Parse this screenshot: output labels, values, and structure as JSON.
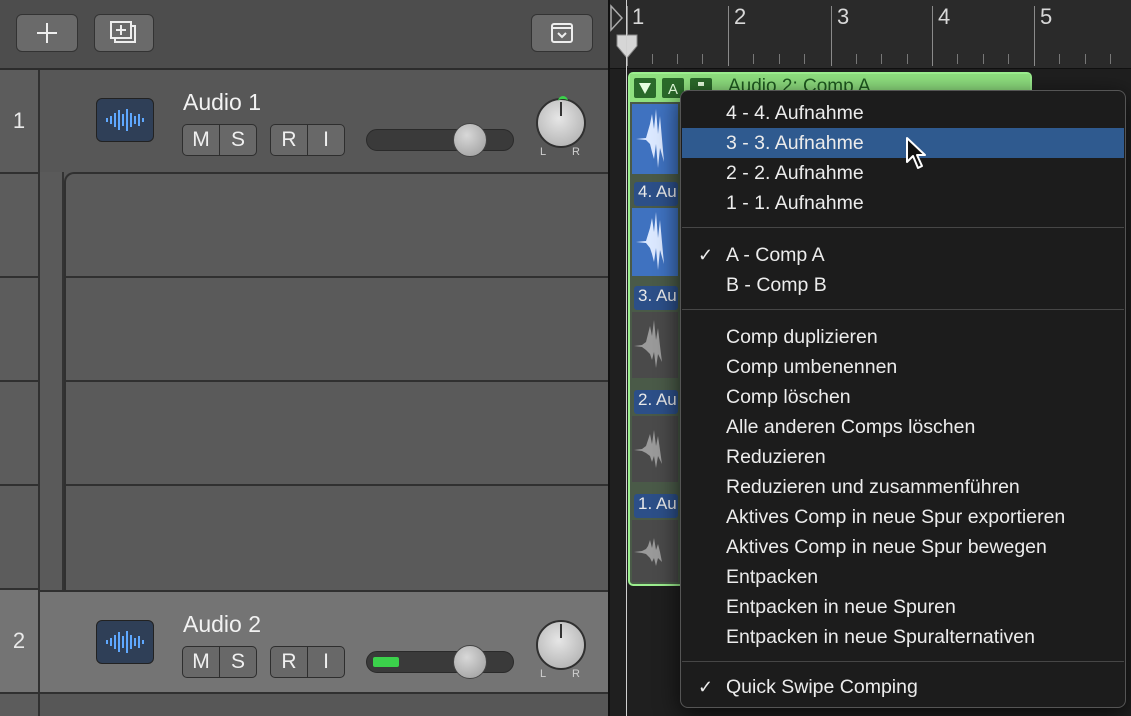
{
  "toolbar": {
    "add_track_icon": "plus-icon",
    "new_track_icon": "add-track-icon",
    "filter_icon": "tray-chevron-icon"
  },
  "tracks": [
    {
      "number": "1",
      "name": "Audio 1",
      "buttons": [
        "M",
        "S",
        "R",
        "I"
      ],
      "pan_left": "L",
      "pan_right": "R"
    },
    {
      "number": "2",
      "name": "Audio 2",
      "buttons": [
        "M",
        "S",
        "R",
        "I"
      ],
      "pan_left": "L",
      "pan_right": "R"
    }
  ],
  "ruler": {
    "bars": [
      "1",
      "2",
      "3",
      "4",
      "5"
    ]
  },
  "region": {
    "header_title": "Audio 2: Comp A",
    "take_labels": [
      "4. Au",
      "3. Au",
      "2. Au",
      "1. Au"
    ]
  },
  "context_menu": {
    "takes": [
      {
        "label": "4 - 4. Aufnahme",
        "highlighted": false
      },
      {
        "label": "3 - 3. Aufnahme",
        "highlighted": true
      },
      {
        "label": "2 - 2. Aufnahme",
        "highlighted": false
      },
      {
        "label": "1 - 1. Aufnahme",
        "highlighted": false
      }
    ],
    "comps": [
      {
        "label": "A - Comp A",
        "checked": true
      },
      {
        "label": "B - Comp B",
        "checked": false
      }
    ],
    "actions": [
      "Comp duplizieren",
      "Comp umbenennen",
      "Comp löschen",
      "Alle anderen Comps löschen",
      "Reduzieren",
      "Reduzieren und zusammenführen",
      "Aktives Comp in neue Spur exportieren",
      "Aktives Comp in neue Spur bewegen",
      "Entpacken",
      "Entpacken in neue Spuren",
      "Entpacken in neue Spuralternativen"
    ],
    "quick_swipe": {
      "label": "Quick Swipe Comping",
      "checked": true
    },
    "check_mark": "✓"
  },
  "colors": {
    "menu_highlight": "#2f5a8f",
    "region_green": "#8fe07f",
    "take_blue": "#3f72c0",
    "meter_green": "#3bd14b"
  }
}
